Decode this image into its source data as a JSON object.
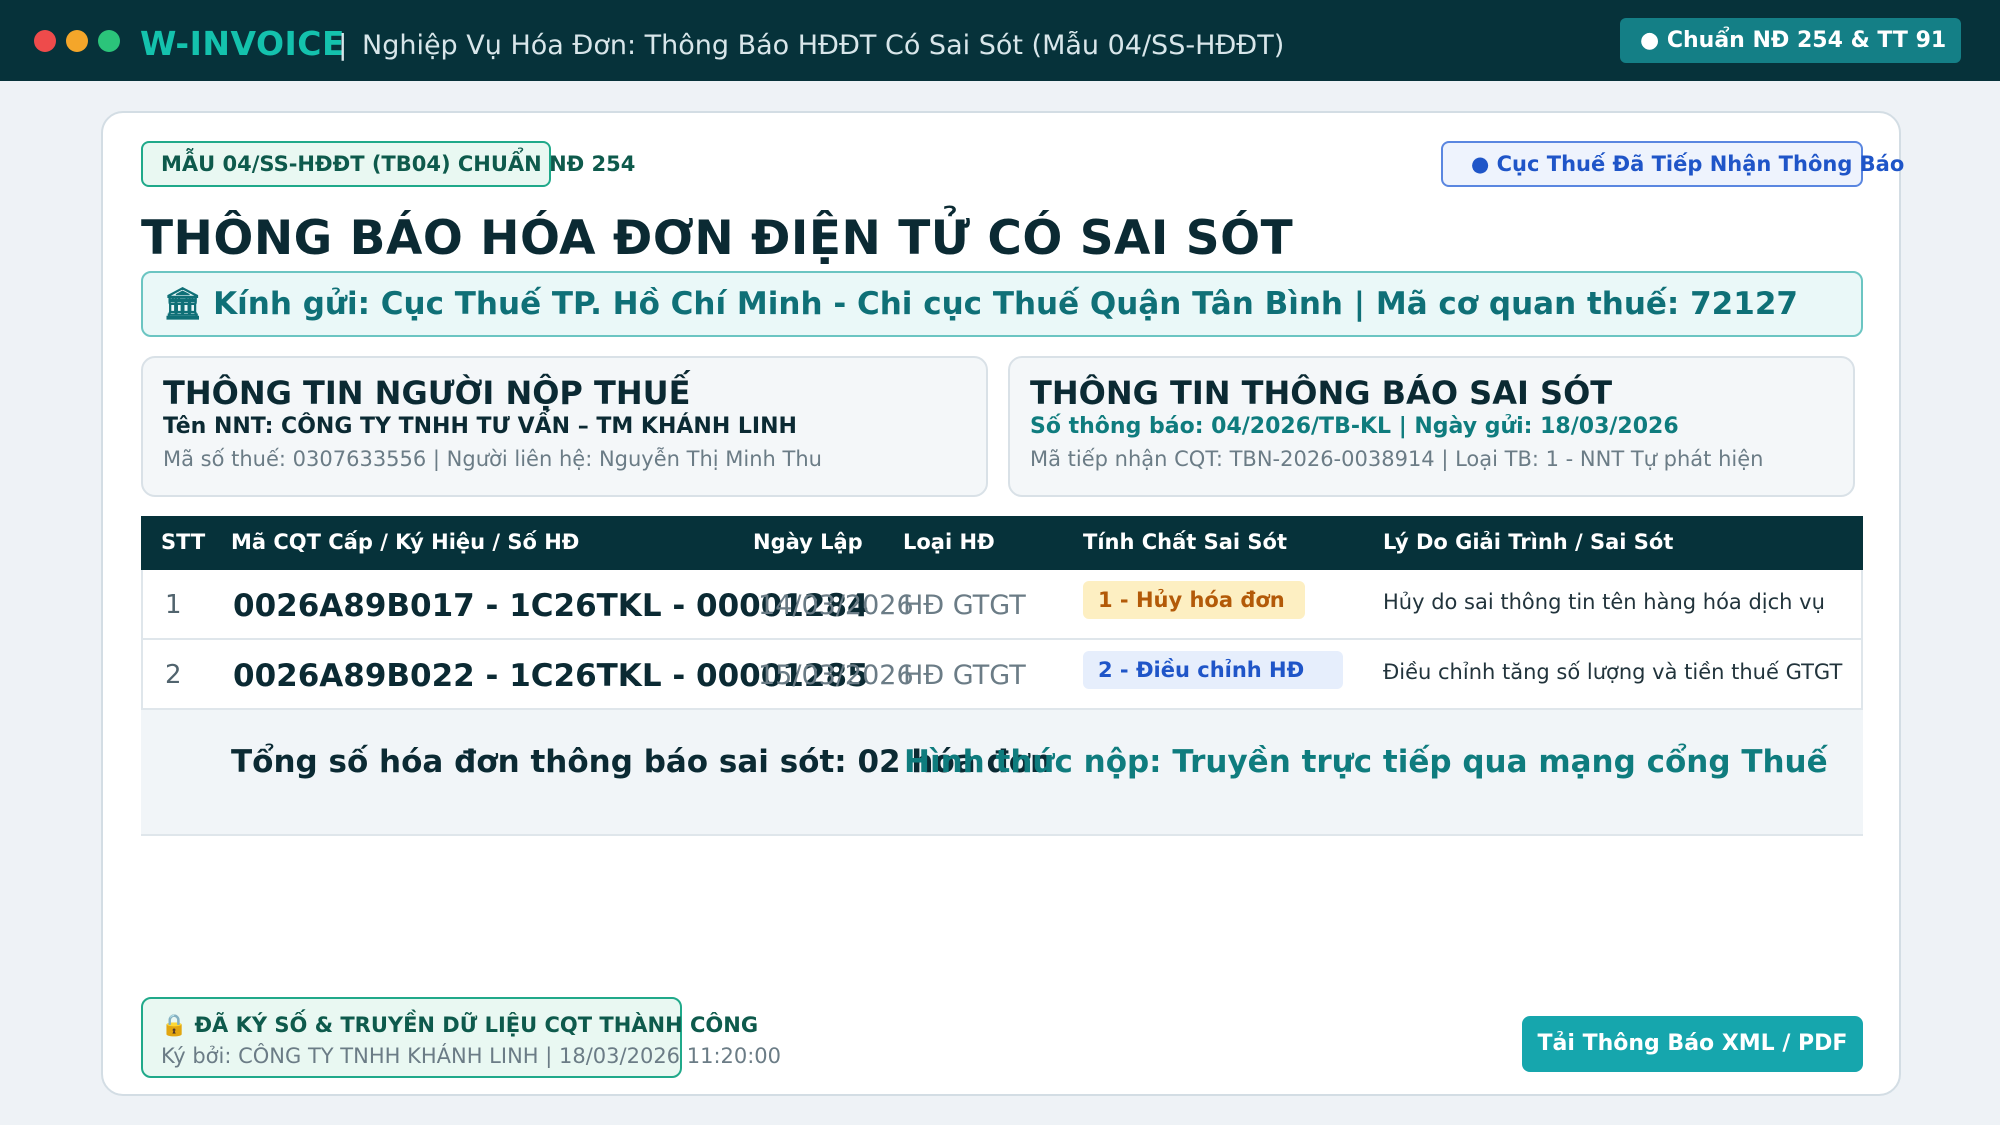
{
  "window": {
    "traffic_lights": [
      "#ee4b4b",
      "#f4a62a",
      "#2bc47a"
    ]
  },
  "header": {
    "brand": "W-INVOICE",
    "separator": "|",
    "title": "Nghiệp Vụ Hóa Đơn: Thông Báo HĐĐT Có Sai Sót (Mẫu 04/SS-HĐĐT)",
    "standard_badge": "● Chuẩn NĐ 254 & TT 91"
  },
  "form": {
    "form_tag": "MẪU 04/SS-HĐĐT (TB04) CHUẨN NĐ 254",
    "status_tag": "● Cục Thuế Đã Tiếp Nhận Thông Báo",
    "heading": "THÔNG BÁO HÓA ĐƠN ĐIỆN TỬ CÓ SAI SÓT",
    "recipient": "🏛 Kính gửi: Cục Thuế TP. Hồ Chí Minh - Chi cục Thuế Quận Tân Bình | Mã cơ quan thuế: 72127"
  },
  "taxpayer": {
    "heading": "THÔNG TIN NGƯỜI NỘP THUẾ",
    "name_line": "Tên NNT: CÔNG TY TNHH TƯ VẤN – TM KHÁNH LINH",
    "detail_line": "Mã số thuế: 0307633556 | Người liên hệ: Nguyễn Thị Minh Thu"
  },
  "notice": {
    "heading": "THÔNG TIN THÔNG BÁO SAI SÓT",
    "number_line": "Số thông báo: 04/2026/TB-KL | Ngày gửi: 18/03/2026",
    "detail_line": "Mã tiếp nhận CQT: TBN-2026-0038914 | Loại TB: 1 - NNT Tự phát hiện"
  },
  "table": {
    "headers": [
      "STT",
      "Mã CQT Cấp / Ký Hiệu / Số HĐ",
      "Ngày Lập",
      "Loại HĐ",
      "Tính Chất Sai Sót",
      "Lý Do Giải Trình / Sai Sót"
    ],
    "rows": [
      {
        "stt": "1",
        "code": "0026A89B017 - 1C26TKL - 00001284",
        "date": "14/03/2026",
        "type": "HĐ GTGT",
        "nature": "1 - Hủy hóa đơn",
        "reason": "Hủy do sai thông tin tên hàng hóa dịch vụ"
      },
      {
        "stt": "2",
        "code": "0026A89B022 - 1C26TKL - 00001285",
        "date": "15/03/2026",
        "type": "HĐ GTGT",
        "nature": "2 - Điều chỉnh HĐ",
        "reason": "Điều chỉnh tăng số lượng và tiền thuế GTGT"
      }
    ],
    "total": "Tổng số hóa đơn thông báo sai sót: 02 hóa đơn",
    "method": "Hình thức nộp: Truyền trực tiếp qua mạng cổng Thuế"
  },
  "footer": {
    "signed_title": "🔒 ĐÃ KÝ SỐ & TRUYỀN DỮ LIỆU CQT THÀNH CÔNG",
    "signed_detail": "Ký bởi: CÔNG TY TNHH KHÁNH LINH | 18/03/2026 11:20:00",
    "download_label": "Tải Thông Báo XML / PDF"
  }
}
